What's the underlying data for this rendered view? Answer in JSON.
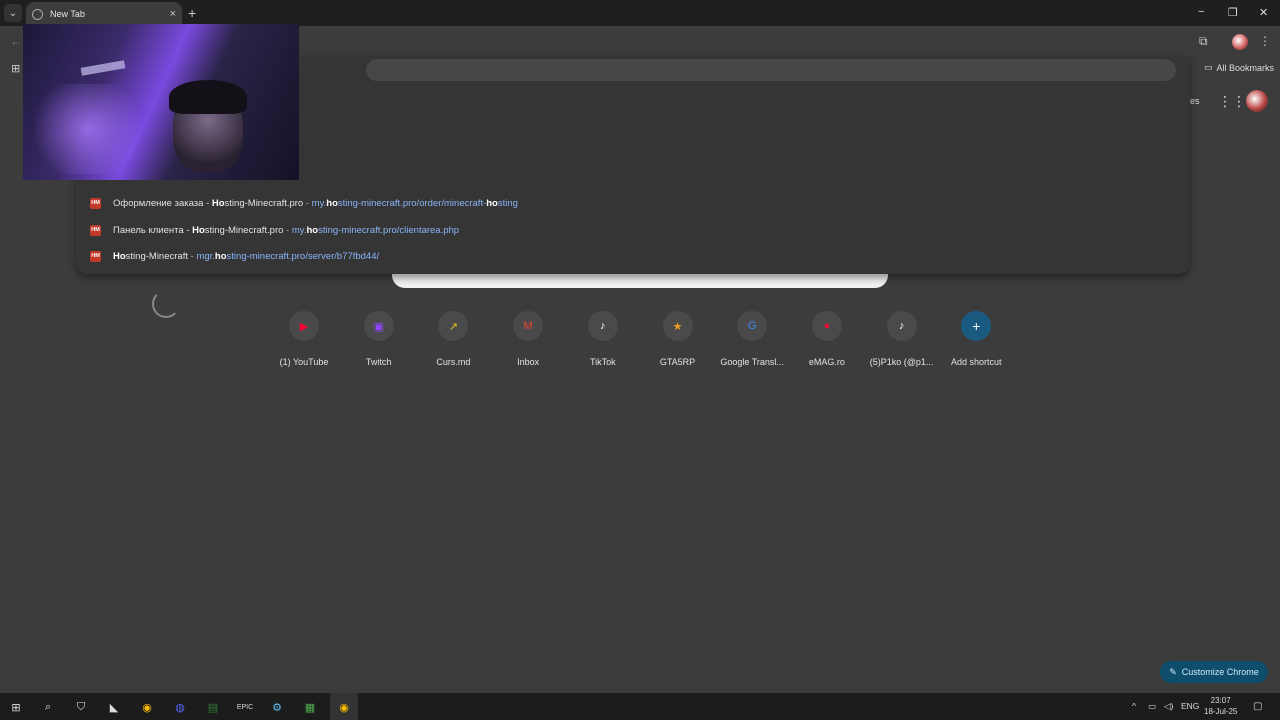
{
  "tab": {
    "title": "New Tab",
    "close": "×",
    "new_tab": "+"
  },
  "window": {
    "minimize": "−",
    "restore": "❐",
    "close": "✕"
  },
  "bookmarks": {
    "all_label": "All Bookmarks"
  },
  "suggestions": [
    {
      "title_pre": "Оформление заказа - ",
      "title_bold": "Ho",
      "title_post": "sting-Minecraft.pro",
      "sep": " - ",
      "url_pre": "my.",
      "url_bold": "ho",
      "url_mid": "sting-minecraft.pro/order/minecraft-",
      "url_bold2": "ho",
      "url_post": "sting",
      "icon": "HM"
    },
    {
      "title_pre": "Панель клиента - ",
      "title_bold": "Ho",
      "title_post": "sting-Minecraft.pro",
      "sep": " - ",
      "url_pre": "my.",
      "url_bold": "ho",
      "url_mid": "sting-minecraft.pro/clientarea.php",
      "url_bold2": "",
      "url_post": "",
      "icon": "HM"
    },
    {
      "title_pre": "",
      "title_bold": "Ho",
      "title_post": "sting-Minecraft",
      "sep": " - ",
      "url_pre": "mgr.",
      "url_bold": "ho",
      "url_mid": "sting-minecraft.pro/server/b77fbd44/",
      "url_bold2": "",
      "url_post": "",
      "icon": "HM"
    }
  ],
  "header_right": {
    "partial_label": "es"
  },
  "shortcuts": [
    {
      "label": "(1) YouTube",
      "glyph": "▶",
      "color": "#ff0033"
    },
    {
      "label": "Twitch",
      "glyph": "▣",
      "color": "#9146ff"
    },
    {
      "label": "Curs.md",
      "glyph": "↗",
      "color": "#e0c020"
    },
    {
      "label": "Inbox",
      "glyph": "M",
      "color": "#ea4335"
    },
    {
      "label": "TikTok",
      "glyph": "♪",
      "color": "#ffffff"
    },
    {
      "label": "GTA5RP",
      "glyph": "★",
      "color": "#f0a020"
    },
    {
      "label": "Google Transl...",
      "glyph": "G",
      "color": "#4285f4"
    },
    {
      "label": "eMAG.ro",
      "glyph": "●",
      "color": "#e0103a"
    },
    {
      "label": "(5)P1ko (@p1...",
      "glyph": "♪",
      "color": "#ffffff"
    },
    {
      "label": "Add shortcut",
      "glyph": "+",
      "color": "#ffffff"
    }
  ],
  "customize": {
    "label": "Customize Chrome",
    "icon": "✎"
  },
  "taskbar": {
    "lang": "ENG",
    "time": "23:07",
    "date": "18-Jul-25"
  }
}
